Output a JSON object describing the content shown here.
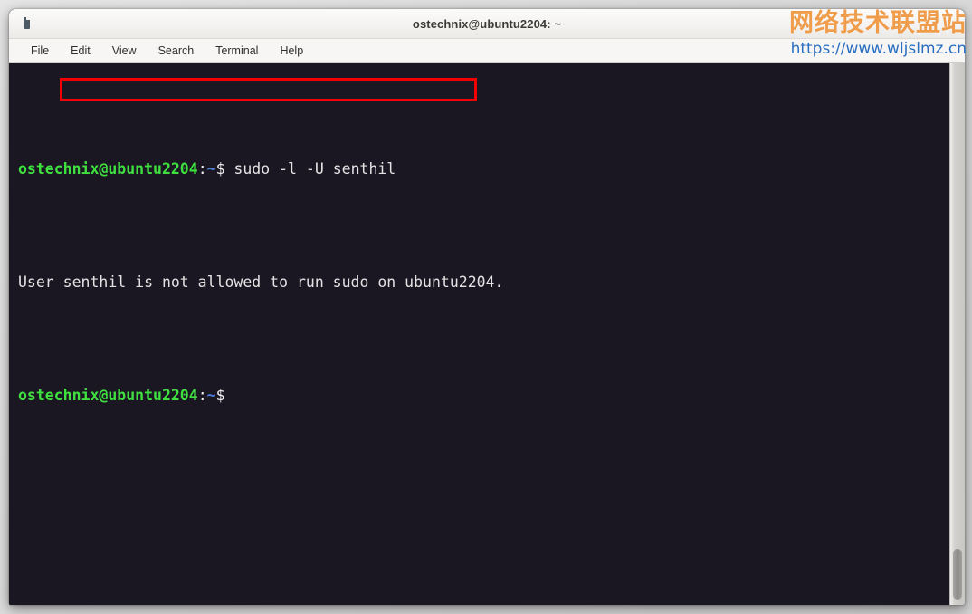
{
  "window": {
    "title": "ostechnix@ubuntu2204: ~",
    "icon": "terminal-icon"
  },
  "menubar": {
    "items": [
      {
        "label": "File"
      },
      {
        "label": "Edit"
      },
      {
        "label": "View"
      },
      {
        "label": "Search"
      },
      {
        "label": "Terminal"
      },
      {
        "label": "Help"
      }
    ]
  },
  "terminal": {
    "lines": [
      {
        "type": "prompt-command",
        "user_host": "ostechnix@ubuntu2204",
        "colon": ":",
        "path": "~",
        "sigil": "$",
        "command": " sudo -l -U senthil"
      },
      {
        "type": "output",
        "text": "User senthil is not allowed to run sudo on ubuntu2204."
      },
      {
        "type": "prompt",
        "user_host": "ostechnix@ubuntu2204",
        "colon": ":",
        "path": "~",
        "sigil": "$",
        "command": ""
      }
    ],
    "highlight": {
      "name": "red-annotation-box",
      "text": "senthil is not allowed to run sudo",
      "color": "#f40000"
    },
    "colors": {
      "background": "#1a1722",
      "foreground": "#e3e3e3",
      "prompt_green": "#3fe03f",
      "path_blue": "#4e7fe0"
    }
  },
  "scrollbar": {
    "position": "bottom"
  },
  "watermark": {
    "brand": "网络技术联盟站",
    "url": "https://www.wljslmz.cn",
    "brand_color": "#ef9c4b",
    "url_color": "#2a6ec0"
  }
}
